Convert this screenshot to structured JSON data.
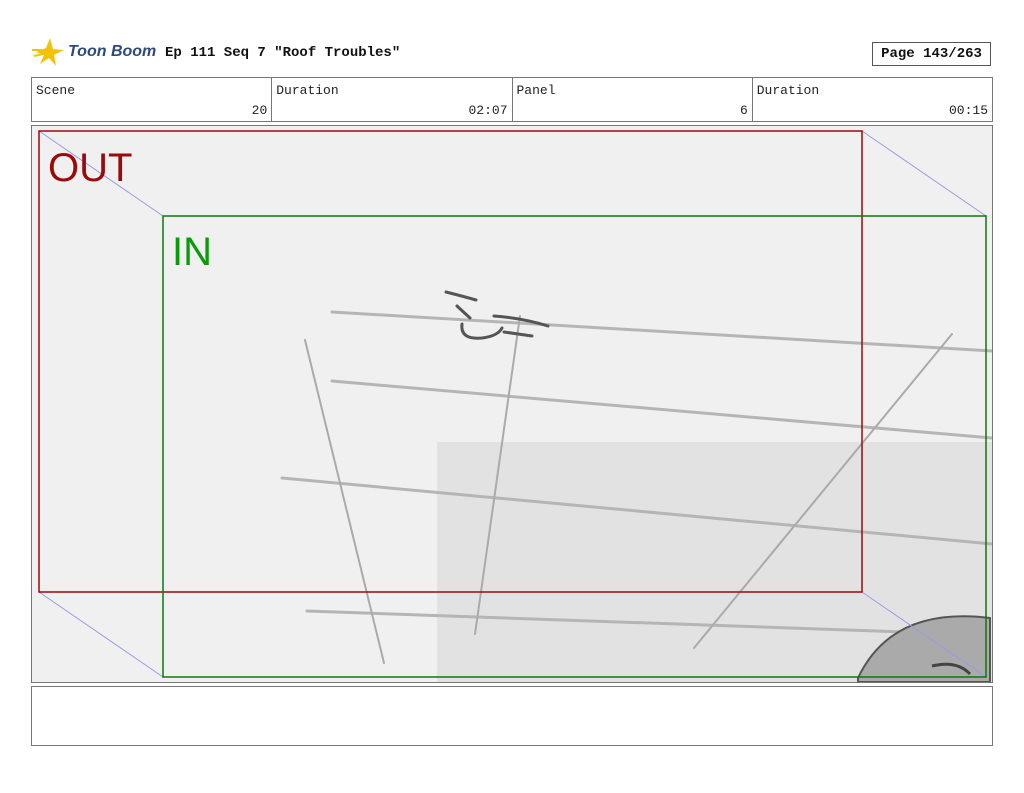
{
  "header": {
    "brand": "Toon Boom",
    "title": "Ep 111 Seq 7 \"Roof Troubles\"",
    "page": "Page 143/263"
  },
  "info": {
    "scene_label": "Scene",
    "scene_value": "20",
    "duration_label": "Duration",
    "duration_value": "02:07",
    "panel_label": "Panel",
    "panel_value": "6",
    "panel_duration_label": "Duration",
    "panel_duration_value": "00:15"
  },
  "frame": {
    "out_label": "OUT",
    "in_label": "IN",
    "out_color": "#9b0a0a",
    "in_color": "#0a9b0a",
    "guide_color": "#9a9ae6"
  },
  "caption": {
    "text": ""
  }
}
